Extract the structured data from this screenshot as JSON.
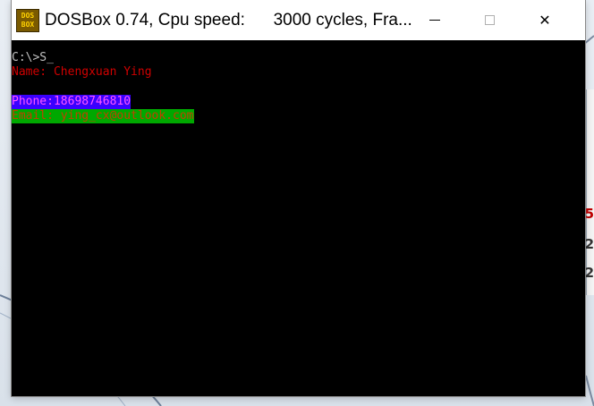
{
  "window": {
    "title": "DOSBox 0.74, Cpu speed:      3000 cycles, Fra...",
    "icon_line1": "DOS",
    "icon_line2": "BOX"
  },
  "controls": {
    "minimize": "minimize-icon",
    "maximize": "maximize-icon",
    "close": "close-icon",
    "close_glyph": "✕"
  },
  "screen": {
    "prompt": "C:\\>S",
    "cursor": "_",
    "name_line": "Name: Chengxuan Ying",
    "phone_line": "Phone:18698746810",
    "email_line": "Email: ying_cx@outlook.com"
  },
  "background": {
    "edge_chars": [
      "5",
      "2",
      "2"
    ]
  },
  "colors": {
    "screen_bg": "#000000",
    "prompt": "#c0c0c0",
    "name": "#d00000",
    "phone_fg": "#ff55ff",
    "phone_bg": "#3a00ff",
    "email_fg": "#c04000",
    "email_bg": "#00a800"
  }
}
